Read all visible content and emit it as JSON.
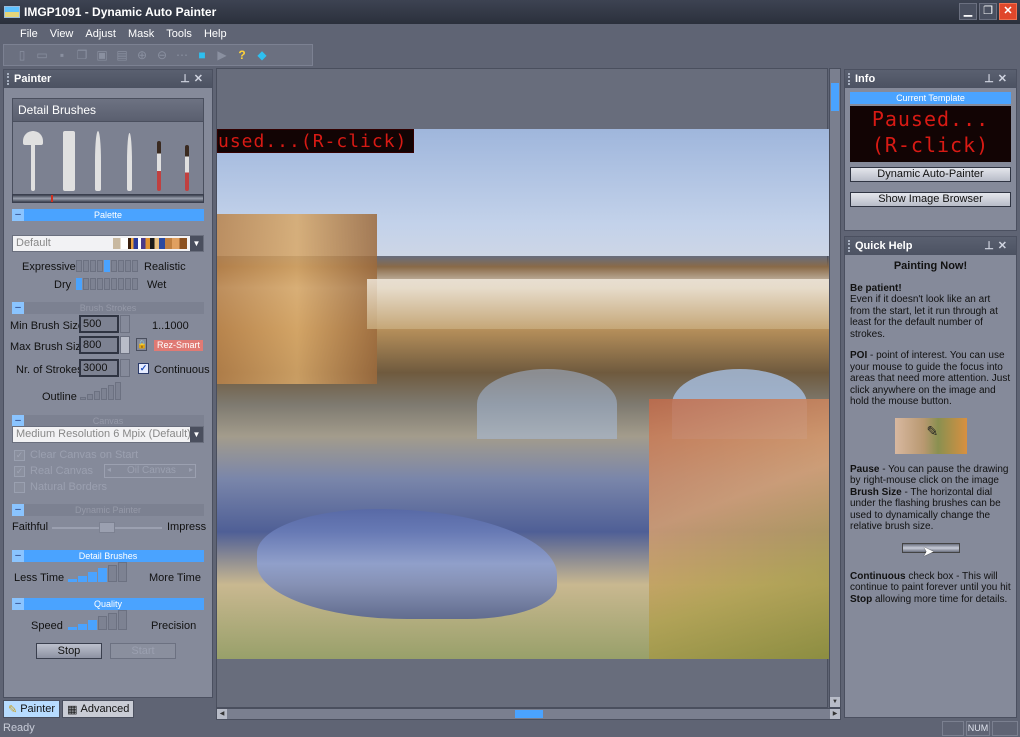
{
  "window": {
    "title": "IMGP1091 - Dynamic Auto Painter",
    "controls": [
      "minimize",
      "restore",
      "close"
    ]
  },
  "menu": [
    "File",
    "View",
    "Adjust",
    "Mask",
    "Tools",
    "Help"
  ],
  "toolbar": {
    "icons": [
      "new-icon",
      "open-icon",
      "save-icon",
      "copy-icon",
      "paste-icon",
      "export-icon",
      "zoom-in-icon",
      "zoom-out-icon",
      "fit-icon",
      "stop-icon",
      "play-icon",
      "help-icon",
      "image-browser-icon"
    ]
  },
  "painter_panel": {
    "title": "Painter",
    "brush_header": "Detail Brushes",
    "palette_section": "Palette",
    "palette_selected": "Default",
    "expressive_label": "Expressive",
    "realistic_label": "Realistic",
    "expressive_realistic_level": 0.5,
    "dry_label": "Dry",
    "wet_label": "Wet",
    "dry_wet_level": 0.0,
    "brush_strokes_section": "Brush Strokes",
    "min_brush_label": "Min Brush Size",
    "min_brush_value": "500",
    "range_label": "1..1000",
    "max_brush_label": "Max Brush Size",
    "max_brush_value": "800",
    "rez_smart_label": "Rez-Smart",
    "strokes_label": "Nr. of Strokes",
    "strokes_value": "3000",
    "continuous_label": "Continuous",
    "continuous_checked": true,
    "outline_label": "Outline",
    "outline_level": 0,
    "canvas_section": "Canvas",
    "canvas_selected": "Medium Resolution 6 Mpix (Default)",
    "clear_canvas_label": "Clear Canvas on Start",
    "real_canvas_label": "Real Canvas",
    "canvas_type": "Oil Canvas",
    "natural_borders_label": "Natural Borders",
    "dynamic_painter_section": "Dynamic Painter",
    "faithful_label": "Faithful",
    "impress_label": "Impress",
    "faithful_impress_level": 0.5,
    "detail_brushes_section": "Detail Brushes",
    "less_time_label": "Less Time",
    "more_time_label": "More Time",
    "detail_level": 4,
    "detail_max": 6,
    "quality_section": "Quality",
    "speed_label": "Speed",
    "precision_label": "Precision",
    "quality_level": 3,
    "quality_max": 6,
    "stop_label": "Stop",
    "start_label": "Start"
  },
  "tabs": [
    {
      "label": "Painter",
      "active": true
    },
    {
      "label": "Advanced",
      "active": false
    }
  ],
  "canvas": {
    "overlay_text": "used...(R-click)"
  },
  "info_panel": {
    "title": "Info",
    "current_template_label": "Current Template",
    "led_line1": "Paused...",
    "led_line2": "(R-click)",
    "template_button": "Dynamic Auto-Painter",
    "browser_button": "Show Image Browser"
  },
  "quick_help": {
    "title": "Quick Help",
    "heading": "Painting Now!",
    "p1_bold": "Be patient!",
    "p1_text": "Even if it doesn't look like an art from the start, let it run through at least for the default number of strokes.",
    "p2_bold": "POI",
    "p2_text": " - point of interest. You can use your mouse to guide the focus into areas that need more attention. Just click anywhere on the image and hold the mouse button.",
    "p3_bold": "Pause",
    "p3_text": " - You can pause the drawing by right-mouse click on the image",
    "p4_bold": "Brush Size",
    "p4_text": " - The horizontal dial under the flashing brushes can be used to dynamically change the relative brush size.",
    "p5_bold": "Continuous",
    "p5_text": " check box - This will continue to paint forever until you hit ",
    "p5_bold2": "Stop",
    "p5_text2": " allowing more time for details."
  },
  "status": {
    "text": "Ready",
    "num_indicator": "NUM"
  },
  "colors": {
    "accent": "#4aa3ff",
    "led_red": "#d81a14",
    "close_button": "#e0472b"
  }
}
